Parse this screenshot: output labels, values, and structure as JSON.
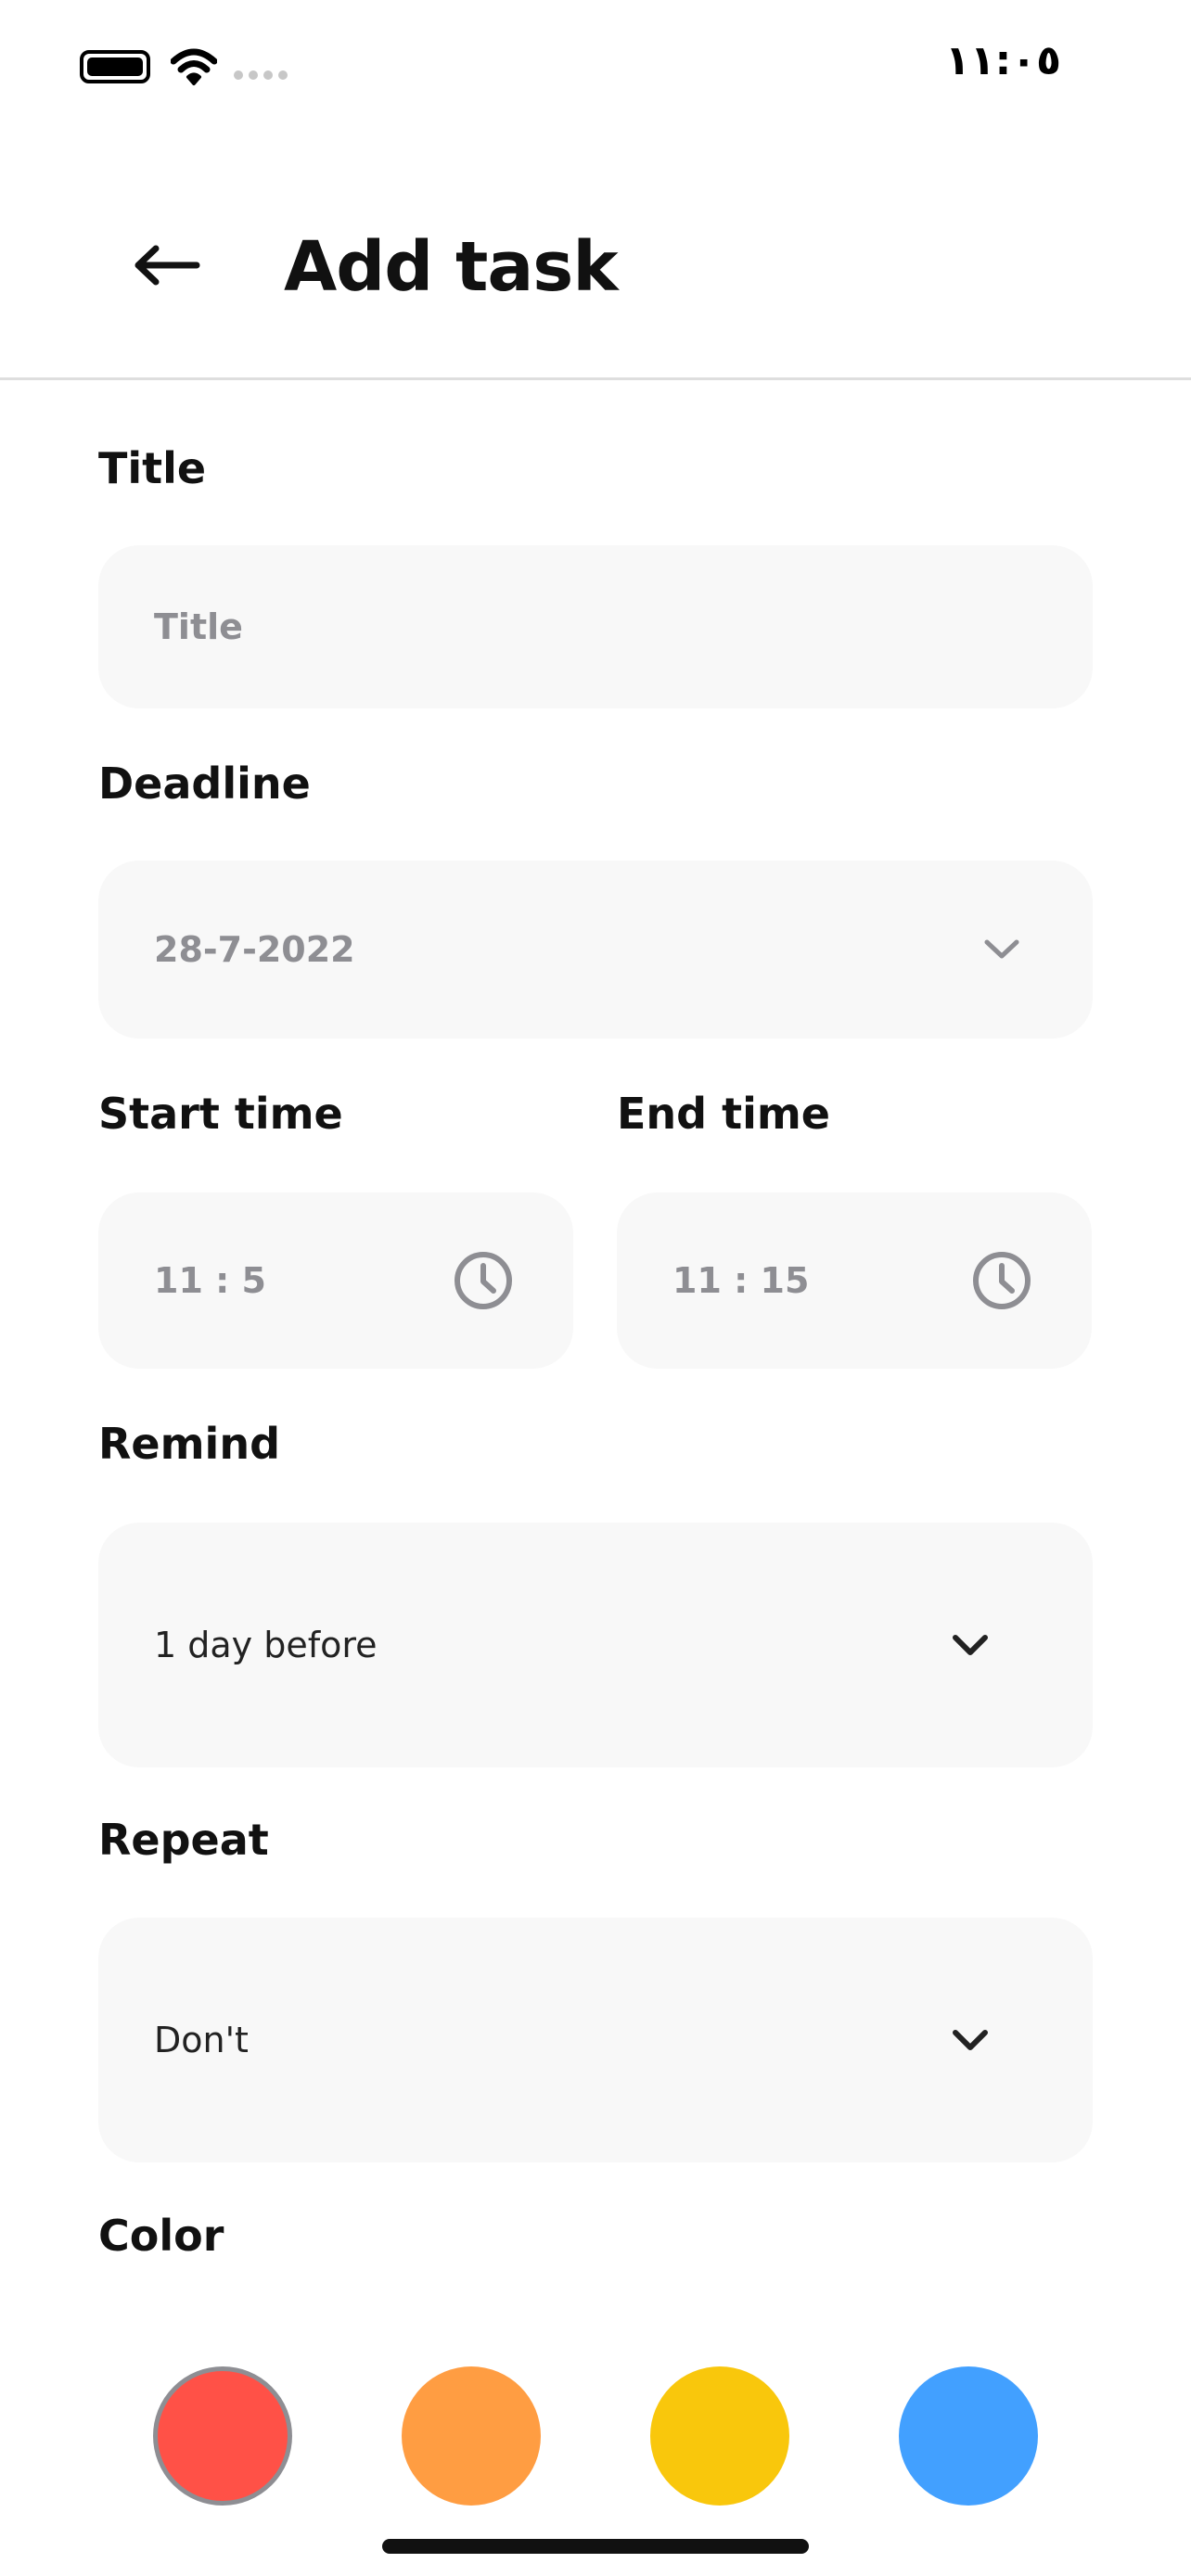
{
  "status_bar": {
    "time": "١١:٠٥",
    "battery_icon": "battery-icon",
    "wifi_icon": "wifi-icon",
    "signal_icon": "signal-dots-icon"
  },
  "header": {
    "back_icon": "arrow-left-icon",
    "title": "Add task"
  },
  "form": {
    "title": {
      "label": "Title",
      "placeholder": "Title"
    },
    "deadline": {
      "label": "Deadline",
      "value": "28-7-2022",
      "icon": "chevron-down-icon"
    },
    "start_time": {
      "label": "Start time",
      "value": "11 : 5",
      "icon": "clock-icon"
    },
    "end_time": {
      "label": "End time",
      "value": "11 : 15",
      "icon": "clock-icon"
    },
    "remind": {
      "label": "Remind",
      "value": "1 day before",
      "icon": "chevron-down-icon"
    },
    "repeat": {
      "label": "Repeat",
      "value": "Don't",
      "icon": "chevron-down-icon"
    },
    "color": {
      "label": "Color",
      "options": [
        {
          "name": "red",
          "hex": "#ff5147",
          "selected": true
        },
        {
          "name": "orange",
          "hex": "#ff9d42"
        },
        {
          "name": "yellow",
          "hex": "#f9c70c"
        },
        {
          "name": "blue",
          "hex": "#42a0ff"
        }
      ],
      "selected_border": "#8e8e93"
    }
  }
}
